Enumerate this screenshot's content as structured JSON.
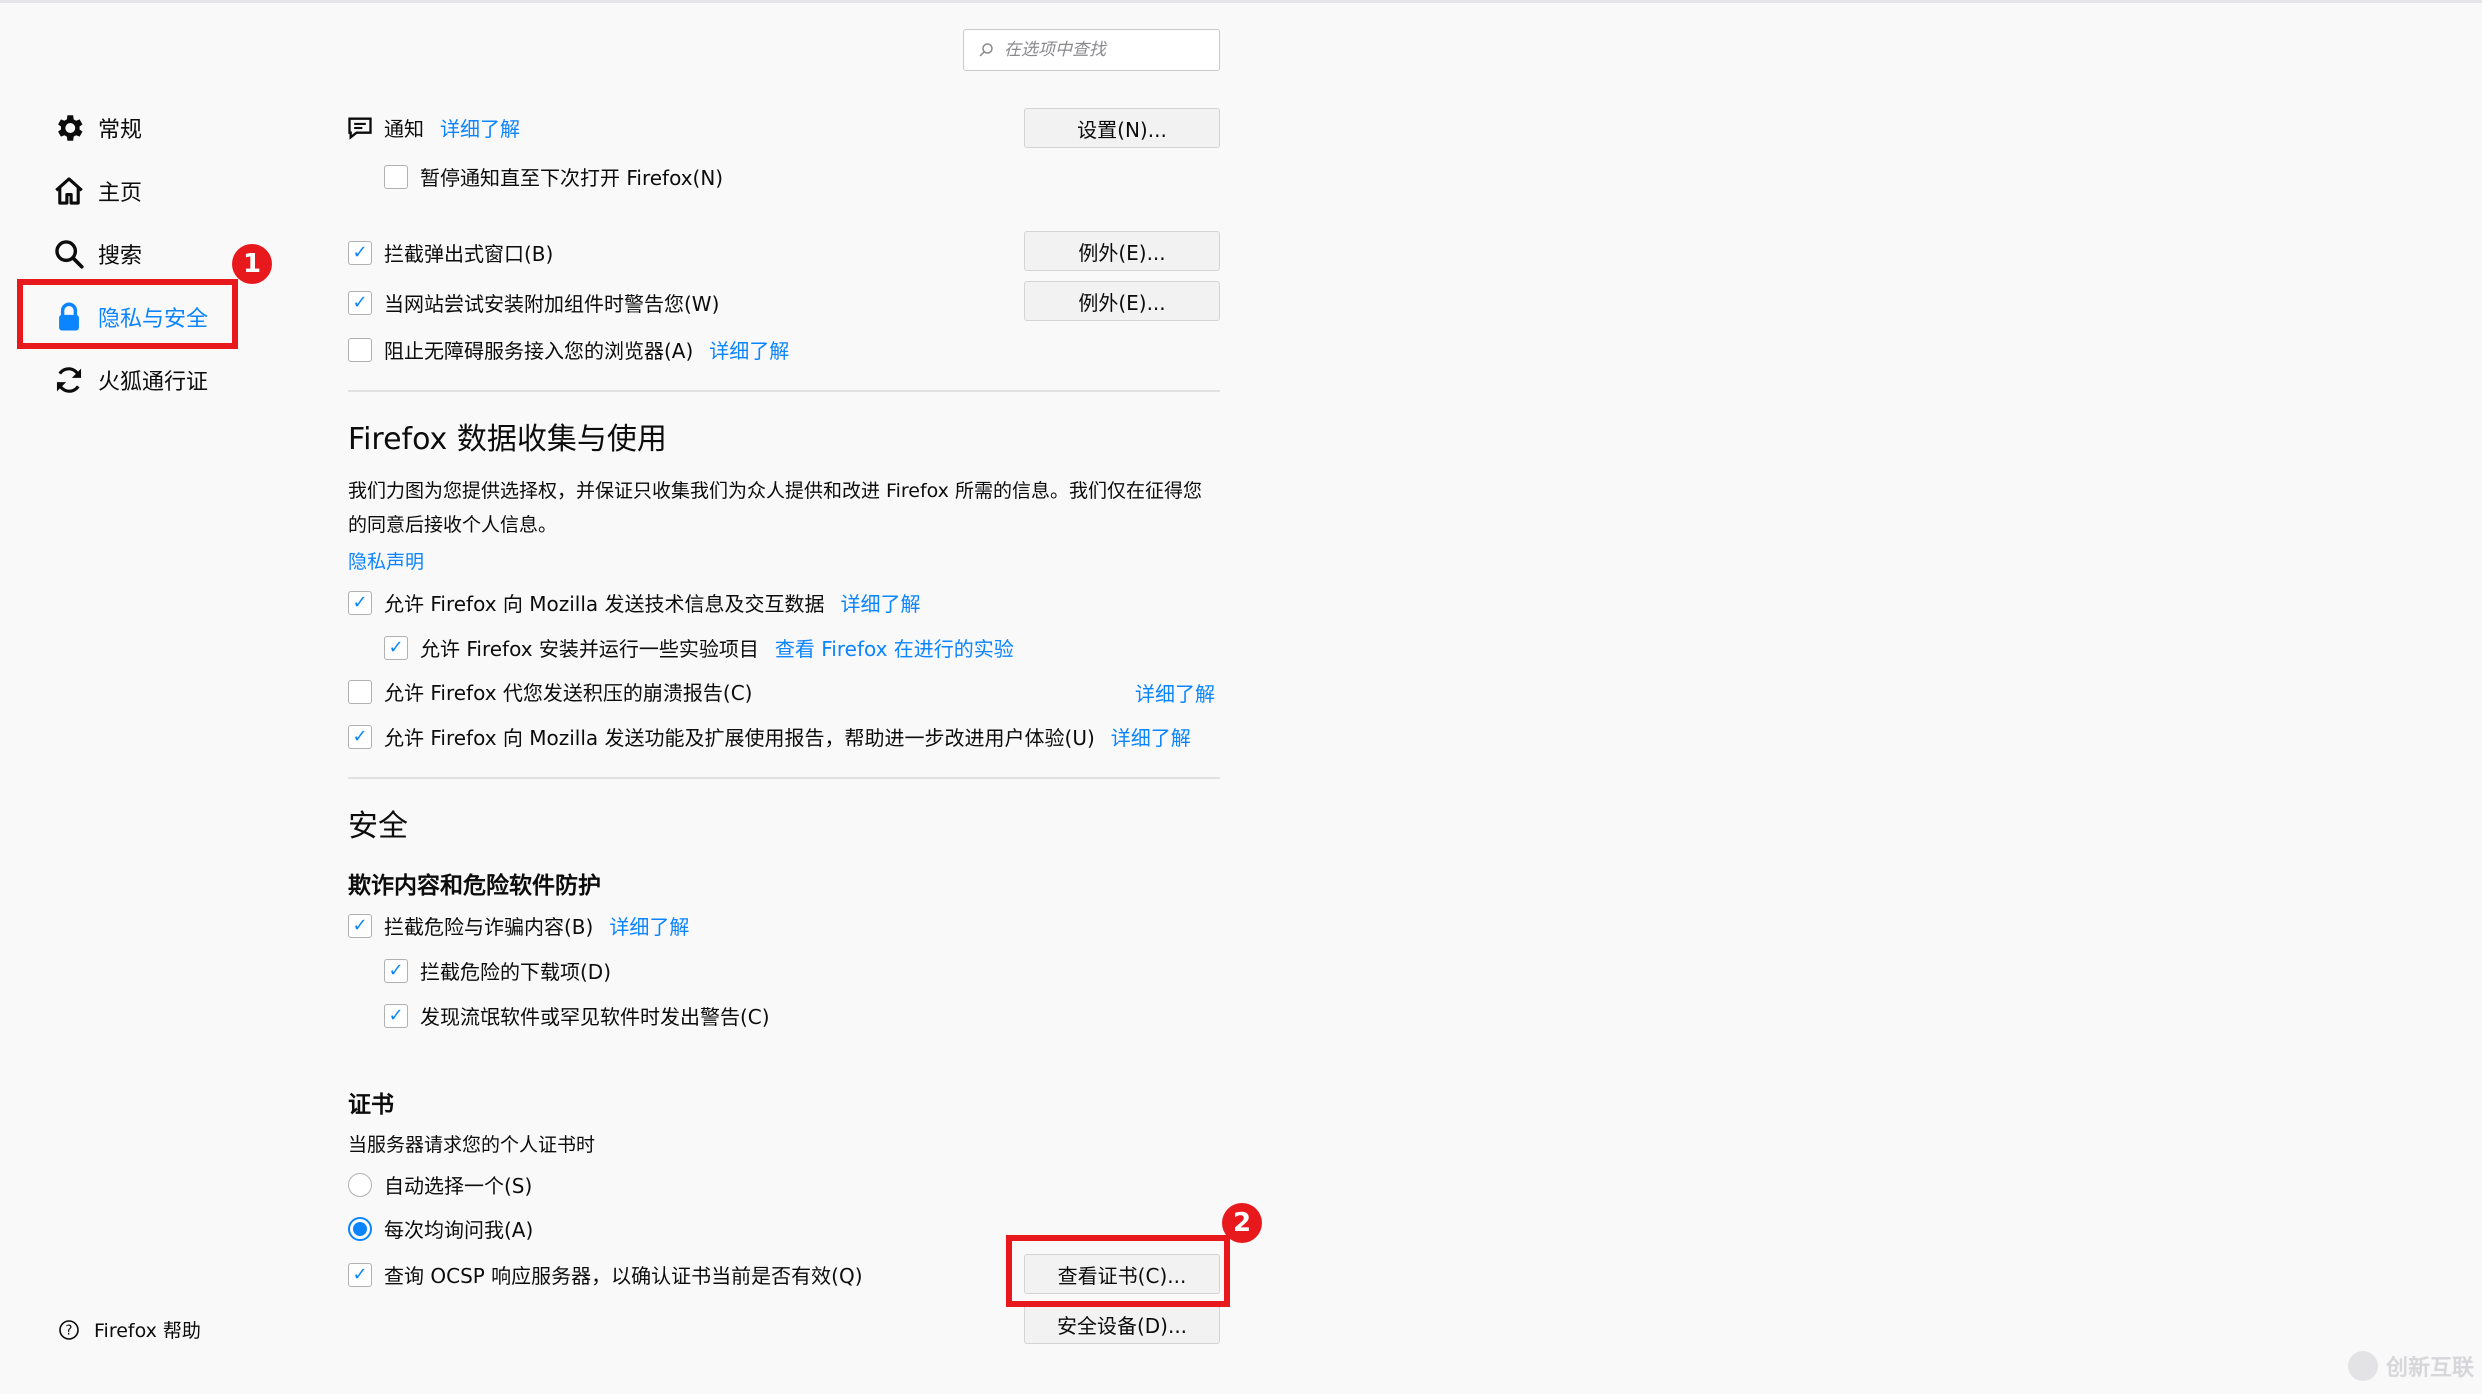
{
  "search": {
    "placeholder": "在选项中查找"
  },
  "sidebar": {
    "items": [
      {
        "label": "常规",
        "icon": "gear-icon"
      },
      {
        "label": "主页",
        "icon": "home-icon"
      },
      {
        "label": "搜索",
        "icon": "search-icon"
      },
      {
        "label": "隐私与安全",
        "icon": "lock-icon",
        "active": true
      },
      {
        "label": "火狐通行证",
        "icon": "sync-icon"
      }
    ],
    "help_label": "Firefox 帮助"
  },
  "annotations": {
    "badge1": "1",
    "badge2": "2"
  },
  "notifications": {
    "label": "通知",
    "learn_more": "详细了解",
    "settings_button": "设置(N)...",
    "pause_label": "暂停通知直至下次打开 Firefox(N)"
  },
  "popups": {
    "block_popups": "拦截弹出式窗口(B)",
    "block_popups_exceptions": "例外(E)...",
    "warn_addons": "当网站尝试安装附加组件时警告您(W)",
    "warn_addons_exceptions": "例外(E)...",
    "block_a11y": "阻止无障碍服务接入您的浏览器(A)",
    "block_a11y_learn_more": "详细了解"
  },
  "data_collection": {
    "heading": "Firefox 数据收集与使用",
    "description": "我们力图为您提供选择权，并保证只收集我们为众人提供和改进 Firefox 所需的信息。我们仅在征得您的同意后接收个人信息。",
    "privacy_notice": "隐私声明",
    "technical_data": "允许 Firefox 向 Mozilla 发送技术信息及交互数据",
    "technical_learn_more": "详细了解",
    "studies": "允许 Firefox 安装并运行一些实验项目",
    "studies_link": "查看 Firefox 在进行的实验",
    "crash_reports": "允许 Firefox 代您发送积压的崩溃报告(C)",
    "crash_learn_more": "详细了解",
    "extension_reports": "允许 Firefox 向 Mozilla 发送功能及扩展使用报告，帮助进一步改进用户体验(U)",
    "extension_learn_more": "详细了解"
  },
  "security": {
    "heading": "安全",
    "subheading": "欺诈内容和危险软件防护",
    "block_dangerous": "拦截危险与诈骗内容(B)",
    "block_dangerous_learn_more": "详细了解",
    "block_downloads": "拦截危险的下载项(D)",
    "warn_unwanted": "发现流氓软件或罕见软件时发出警告(C)"
  },
  "certificates": {
    "heading": "证书",
    "request_label": "当服务器请求您的个人证书时",
    "auto_select": "自动选择一个(S)",
    "ask_every_time": "每次均询问我(A)",
    "ocsp": "查询 OCSP 响应服务器，以确认证书当前是否有效(Q)",
    "view_certificates": "查看证书(C)...",
    "security_devices": "安全设备(D)..."
  },
  "watermark": {
    "text": "创新互联"
  },
  "colors": {
    "accent": "#0a84ff",
    "annotation_red": "#e8191c",
    "background": "#f9f9fa"
  }
}
